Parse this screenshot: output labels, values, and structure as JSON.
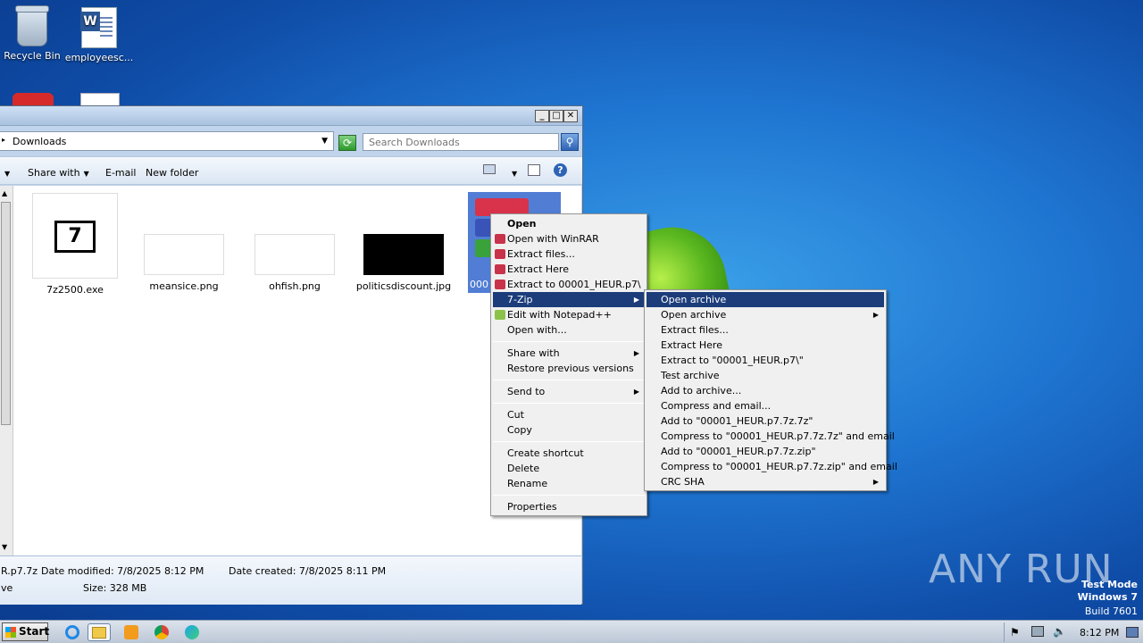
{
  "desktop": {
    "icons": [
      {
        "label": "Recycle Bin"
      },
      {
        "label": "employeesc..."
      }
    ]
  },
  "explorer": {
    "address": "Downloads",
    "search_placeholder": "Search Downloads",
    "commands": [
      "Share with",
      "E-mail",
      "New folder"
    ],
    "files": [
      {
        "name": "7z2500.exe"
      },
      {
        "name": "meansice.png"
      },
      {
        "name": "ohfish.png"
      },
      {
        "name": "politicsdiscount.jpg"
      },
      {
        "name": "000"
      }
    ],
    "details": {
      "name_fragment": "R.p7.7z",
      "type_fragment": "ve",
      "date_modified": "Date modified: 7/8/2025 8:12 PM",
      "date_created": "Date created: 7/8/2025 8:11 PM",
      "size": "Size: 328 MB"
    }
  },
  "context_menu": {
    "items": [
      "Open",
      "Open with WinRAR",
      "Extract files...",
      "Extract Here",
      "Extract to 00001_HEUR.p7\\",
      "7-Zip",
      "Edit with Notepad++",
      "Open with...",
      "Share with",
      "Restore previous versions",
      "Send to",
      "Cut",
      "Copy",
      "Create shortcut",
      "Delete",
      "Rename",
      "Properties"
    ]
  },
  "submenu_7zip": {
    "items": [
      "Open archive",
      "Open archive",
      "Extract files...",
      "Extract Here",
      "Extract to \"00001_HEUR.p7\\\"",
      "Test archive",
      "Add to archive...",
      "Compress and email...",
      "Add to \"00001_HEUR.p7.7z.7z\"",
      "Compress to \"00001_HEUR.p7.7z.7z\" and email",
      "Add to \"00001_HEUR.p7.7z.zip\"",
      "Compress to \"00001_HEUR.p7.7z.zip\" and email",
      "CRC SHA"
    ]
  },
  "watermark": {
    "brand": "ANY RUN",
    "mode": "Test Mode",
    "os": "Windows 7",
    "build": "Build 7601"
  },
  "taskbar": {
    "start_label": "Start",
    "clock": "8:12 PM"
  }
}
